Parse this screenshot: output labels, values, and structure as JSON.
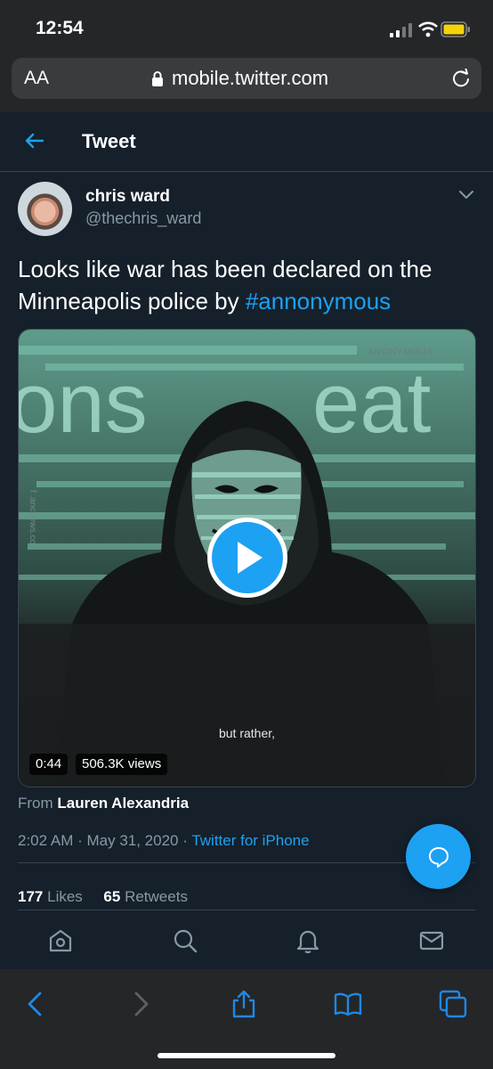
{
  "status_bar": {
    "time": "12:54"
  },
  "browser": {
    "text_size_label": "AA",
    "url": "mobile.twitter.com"
  },
  "header": {
    "title": "Tweet"
  },
  "tweet": {
    "author_name": "chris ward",
    "author_handle": "@thechris_ward",
    "text_before": "Looks like war has been declared on the Minneapolis police by ",
    "hashtag": "#annonymous",
    "media": {
      "watermark": "ANONYMOUS",
      "side_credit": "f .ancnews.co",
      "subtitle": "but rather,",
      "duration": "0:44",
      "views": "506.3K views"
    },
    "attribution_prefix": "From",
    "attribution_name": "Lauren Alexandria",
    "time": "2:02 AM",
    "date": "May 31, 2020",
    "source": "Twitter for iPhone",
    "likes_count": "177",
    "likes_label": "Likes",
    "retweets_count": "65",
    "retweets_label": "Retweets"
  },
  "icons": {
    "accent": "#1da1f2",
    "tabs": [
      "home-icon",
      "search-icon",
      "notifications-icon",
      "messages-icon"
    ],
    "safari": [
      "back-icon",
      "forward-icon",
      "share-icon",
      "bookmarks-icon",
      "tabs-icon"
    ]
  }
}
